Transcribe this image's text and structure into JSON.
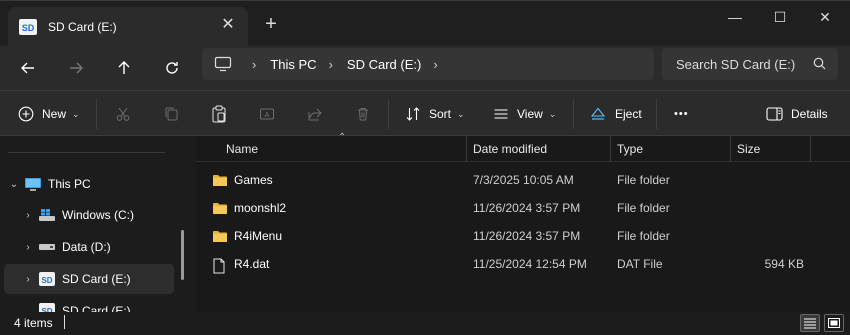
{
  "window": {
    "tab_title": "SD Card (E:)",
    "tab_close": "✕",
    "new_tab": "+",
    "minimize": "—",
    "maximize": "☐",
    "close": "✕"
  },
  "address": {
    "crumbs": [
      "This PC",
      "SD Card (E:)"
    ],
    "search_placeholder": "Search SD Card (E:)"
  },
  "toolbar": {
    "new_label": "New",
    "sort_label": "Sort",
    "view_label": "View",
    "eject_label": "Eject",
    "more_label": "•••",
    "details_label": "Details"
  },
  "navpane": {
    "items": [
      {
        "label": "This PC",
        "icon": "monitor-icon",
        "expanded": true
      },
      {
        "label": "Windows (C:)",
        "icon": "windows-drive-icon"
      },
      {
        "label": "Data (D:)",
        "icon": "drive-icon"
      },
      {
        "label": "SD Card (E:)",
        "icon": "sd-card-icon",
        "selected": true
      },
      {
        "label": "SD Card (E:)",
        "icon": "sd-card-icon"
      }
    ]
  },
  "columns": {
    "name": "Name",
    "date": "Date modified",
    "type": "Type",
    "size": "Size"
  },
  "files": [
    {
      "name": "Games",
      "date": "7/3/2025 10:05 AM",
      "type": "File folder",
      "size": "",
      "kind": "folder"
    },
    {
      "name": "moonshl2",
      "date": "11/26/2024 3:57 PM",
      "type": "File folder",
      "size": "",
      "kind": "folder"
    },
    {
      "name": "R4iMenu",
      "date": "11/26/2024 3:57 PM",
      "type": "File folder",
      "size": "",
      "kind": "folder"
    },
    {
      "name": "R4.dat",
      "date": "11/25/2024 12:54 PM",
      "type": "DAT File",
      "size": "594 KB",
      "kind": "file"
    }
  ],
  "status": {
    "count": "4 items"
  },
  "colors": {
    "folder": "#e8b440",
    "accent": "#4cc2ff"
  }
}
